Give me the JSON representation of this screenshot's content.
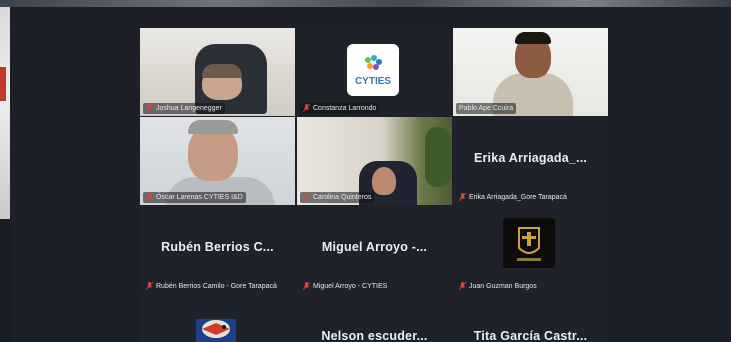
{
  "participants": [
    {
      "name": "Joshua Langenegger",
      "video": true
    },
    {
      "name": "Constanza Larrondo",
      "video": false,
      "logo_text": "CYTIES"
    },
    {
      "name": "Pablo Ape Ccuira",
      "video": true,
      "active_speaker": true
    },
    {
      "name": "Óscar Larenas CYTIES I&D",
      "video": true
    },
    {
      "name": "Carolina Quinteros",
      "video": true
    },
    {
      "name": "Erika Arriagada_Gore Tarapacá",
      "display": "Erika Arriagada_...",
      "video": false
    },
    {
      "name": "Rubén Berrios Camilo - Gore Tarapacá",
      "display": "Rubén Berrios C...",
      "video": false
    },
    {
      "name": "Miguel Arroyo - CYTIES",
      "display": "Miguel Arroyo -...",
      "video": false
    },
    {
      "name": "Juan Guzman Burgos",
      "video": false
    },
    {
      "name": "",
      "video": false
    },
    {
      "name": "",
      "display": "Nelson escuder...",
      "video": false
    },
    {
      "name": "",
      "display": "Tita García Castr...",
      "video": false
    }
  ],
  "colors": {
    "background": "#1d2029",
    "active_border": "#4ed28a",
    "muted_mic": "#e0443a",
    "cyties_blue": "#2b78c9"
  },
  "icons": {
    "mic_muted": "mic-muted-icon"
  }
}
